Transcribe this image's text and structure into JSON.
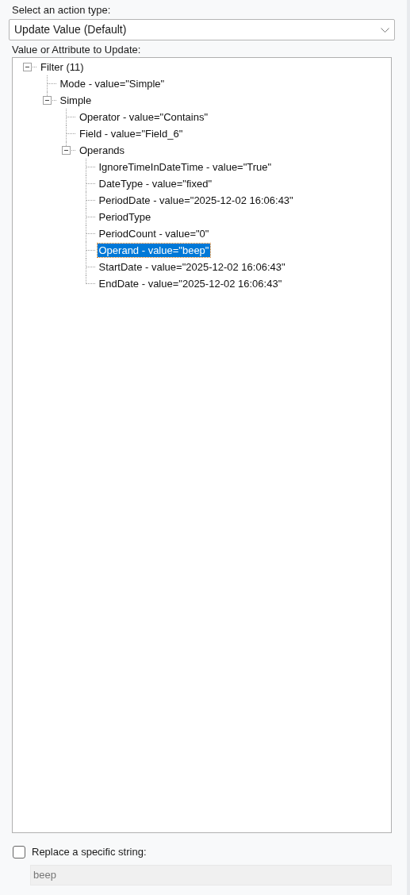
{
  "action_type": {
    "label": "Select an action type:",
    "value": "Update Value (Default)"
  },
  "tree": {
    "label": "Value or Attribute to Update:",
    "nodes": [
      {
        "text": "Filter (11)",
        "selected": false,
        "expanded": true,
        "children": [
          {
            "text": "Mode - value=\"Simple\"",
            "selected": false
          },
          {
            "text": "Simple",
            "selected": false,
            "expanded": true,
            "children": [
              {
                "text": "Operator - value=\"Contains\"",
                "selected": false
              },
              {
                "text": "Field - value=\"Field_6\"",
                "selected": false
              },
              {
                "text": "Operands",
                "selected": false,
                "expanded": true,
                "children": [
                  {
                    "text": "IgnoreTimeInDateTime - value=\"True\"",
                    "selected": false
                  },
                  {
                    "text": "DateType - value=\"fixed\"",
                    "selected": false
                  },
                  {
                    "text": "PeriodDate - value=\"2025-12-02 16:06:43\"",
                    "selected": false
                  },
                  {
                    "text": "PeriodType",
                    "selected": false
                  },
                  {
                    "text": "PeriodCount - value=\"0\"",
                    "selected": false
                  },
                  {
                    "text": "Operand - value=\"beep\"",
                    "selected": true
                  },
                  {
                    "text": "StartDate - value=\"2025-12-02 16:06:43\"",
                    "selected": false
                  },
                  {
                    "text": "EndDate - value=\"2025-12-02 16:06:43\"",
                    "selected": false
                  }
                ]
              }
            ]
          }
        ]
      }
    ]
  },
  "replace": {
    "label": "Replace a specific string:",
    "checked": false,
    "value": "beep",
    "disabled": true
  }
}
